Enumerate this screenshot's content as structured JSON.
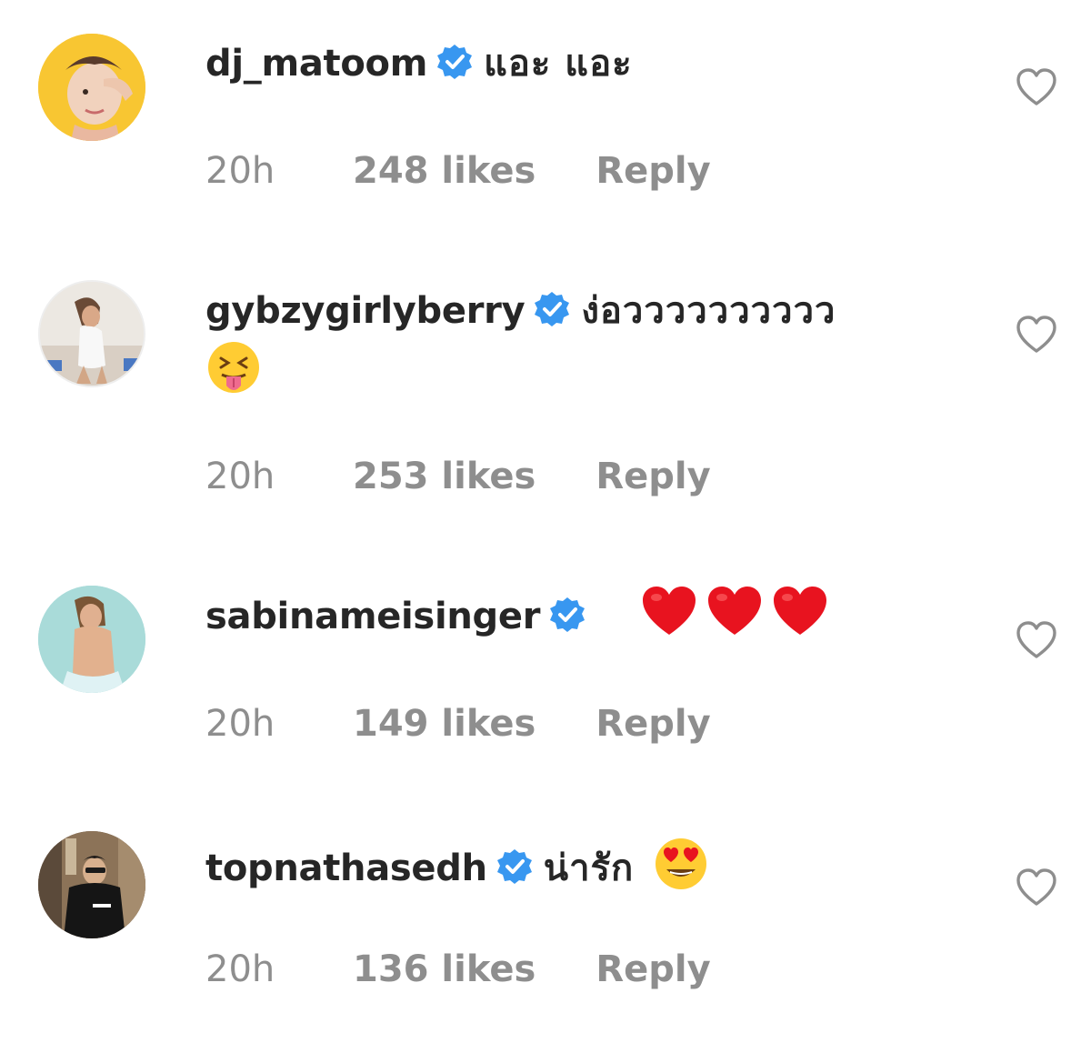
{
  "colors": {
    "text": "#262626",
    "secondary": "#8e8e8e",
    "verified": "#3897f0",
    "heart_emoji": "#e8131f"
  },
  "comments": [
    {
      "username": "dj_matoom",
      "verified": true,
      "text": "แอะ แอะ",
      "emojis": [],
      "time": "20h",
      "likes": "248 likes",
      "reply": "Reply",
      "avatar_icon": "avatar-photo"
    },
    {
      "username": "gybzygirlyberry",
      "verified": true,
      "text": "ง่อวววววววววว",
      "emojis": [
        "squinting-face-with-tongue"
      ],
      "time": "20h",
      "likes": "253 likes",
      "reply": "Reply",
      "avatar_icon": "avatar-photo"
    },
    {
      "username": "sabinameisinger",
      "verified": true,
      "text": "",
      "emojis": [
        "red-heart",
        "red-heart",
        "red-heart"
      ],
      "time": "20h",
      "likes": "149 likes",
      "reply": "Reply",
      "avatar_icon": "avatar-photo"
    },
    {
      "username": "topnathasedh",
      "verified": true,
      "text": "น่ารัก",
      "emojis": [
        "smiling-face-with-heart-eyes"
      ],
      "time": "20h",
      "likes": "136 likes",
      "reply": "Reply",
      "avatar_icon": "avatar-photo"
    }
  ]
}
